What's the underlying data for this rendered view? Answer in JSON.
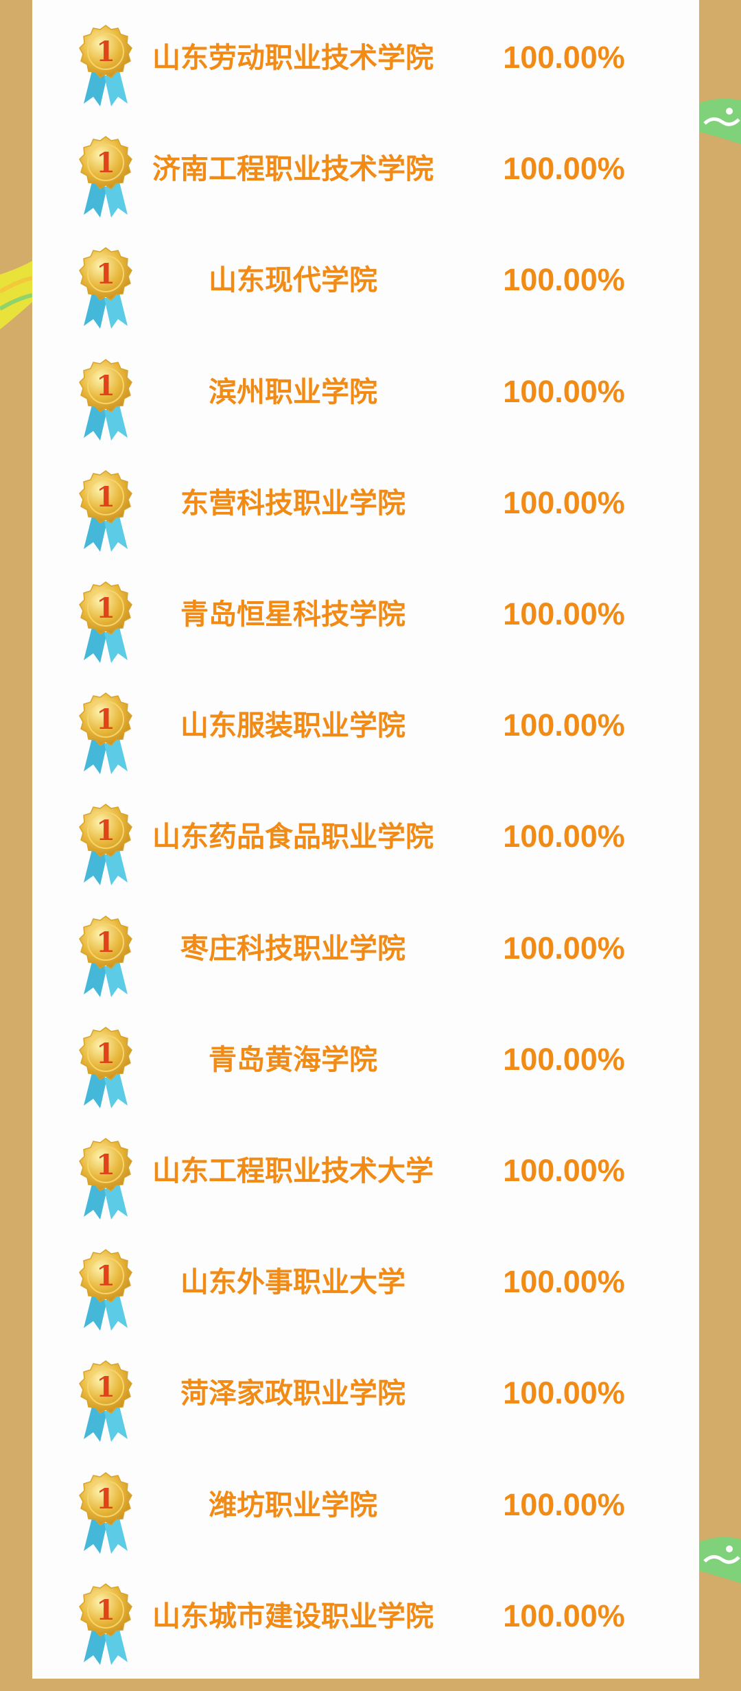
{
  "medal_icon": "gold-medal-rank-1-icon",
  "medal_text": "1",
  "colors": {
    "background": "#D2AC68",
    "panel": "#FDFDFD",
    "text": "#F18B16",
    "medal_gold": "#E8B83C",
    "medal_number": "#E0431B",
    "ribbon": "#45B8DA"
  },
  "rows": [
    {
      "school": "山东劳动职业技术学院",
      "rate": "100.00%"
    },
    {
      "school": "济南工程职业技术学院",
      "rate": "100.00%"
    },
    {
      "school": "山东现代学院",
      "rate": "100.00%"
    },
    {
      "school": "滨州职业学院",
      "rate": "100.00%"
    },
    {
      "school": "东营科技职业学院",
      "rate": "100.00%"
    },
    {
      "school": "青岛恒星科技学院",
      "rate": "100.00%"
    },
    {
      "school": "山东服装职业学院",
      "rate": "100.00%"
    },
    {
      "school": "山东药品食品职业学院",
      "rate": "100.00%"
    },
    {
      "school": "枣庄科技职业学院",
      "rate": "100.00%"
    },
    {
      "school": "青岛黄海学院",
      "rate": "100.00%"
    },
    {
      "school": "山东工程职业技术大学",
      "rate": "100.00%"
    },
    {
      "school": "山东外事职业大学",
      "rate": "100.00%"
    },
    {
      "school": "菏泽家政职业学院",
      "rate": "100.00%"
    },
    {
      "school": "潍坊职业学院",
      "rate": "100.00%"
    },
    {
      "school": "山东城市建设职业学院",
      "rate": "100.00%"
    }
  ]
}
